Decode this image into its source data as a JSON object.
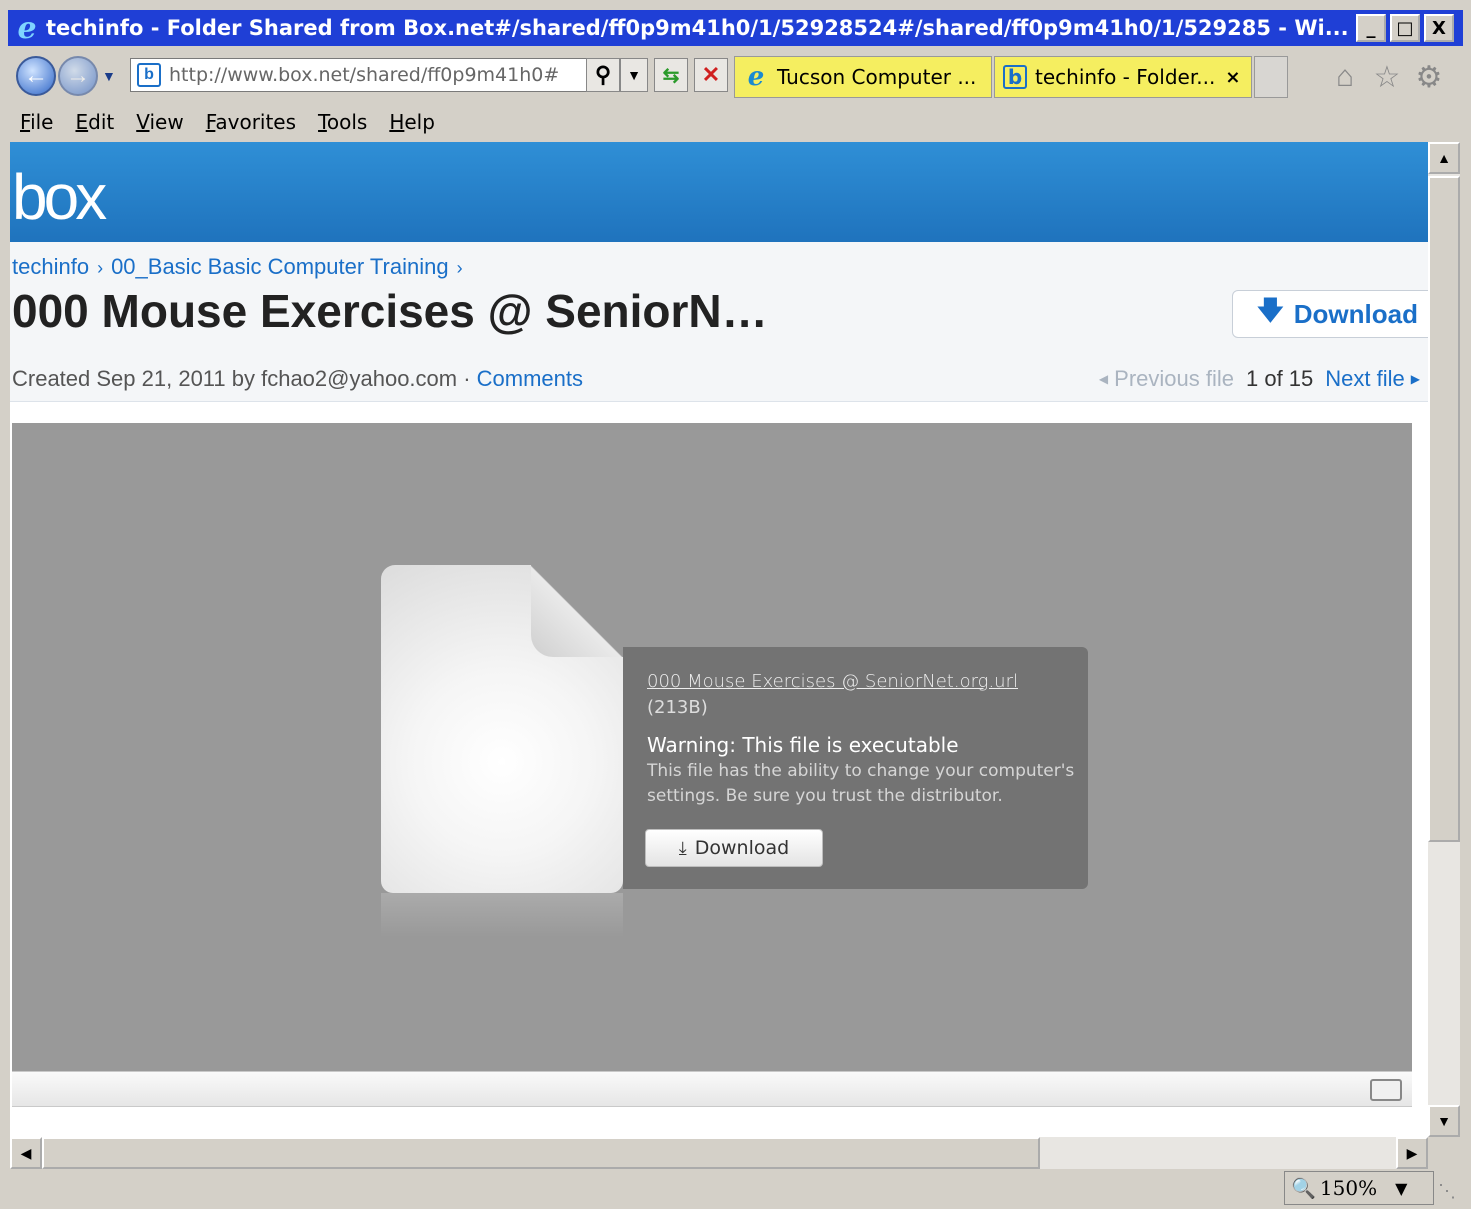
{
  "window": {
    "title": "techinfo - Folder Shared from Box.net#/shared/ff0p9m41h0/1/52928524#/shared/ff0p9m41h0/1/529285 - Wi...",
    "minimize": "_",
    "maximize": "□",
    "close": "X"
  },
  "browser": {
    "address": "http://www.box.net/shared/ff0p9m41h0#",
    "tabs": [
      {
        "label": "Tucson Computer ...",
        "active": false
      },
      {
        "label": "techinfo - Folder...",
        "active": true,
        "close": "×"
      }
    ],
    "menu": [
      "File",
      "Edit",
      "View",
      "Favorites",
      "Tools",
      "Help"
    ],
    "zoom": "150%"
  },
  "page": {
    "logo": "box",
    "breadcrumb": [
      "techinfo",
      "00_Basic Basic Computer Training"
    ],
    "breadcrumb_sep": "›",
    "title": "000 Mouse Exercises @ SeniorN…",
    "download_top": "Download",
    "meta_prefix": "Created Sep 21, 2011 by fchao2@yahoo.com · ",
    "comments": "Comments",
    "pager": {
      "previous": "Previous file",
      "position": "1 of 15",
      "next": "Next file"
    },
    "file": {
      "name": "000 Mouse Exercises @ SeniorNet.org.url",
      "size": "(213B)",
      "warning_title": "Warning: This file is executable",
      "warning_text": "This file has the ability to change your computer's settings. Be sure you trust the distributor.",
      "download": "Download"
    }
  },
  "colors": {
    "titlebar": "#1f3fd6",
    "box_blue": "#2f8fd6",
    "link": "#1a6fc8",
    "preview_bg": "#999999",
    "panel_bg": "#737373"
  }
}
